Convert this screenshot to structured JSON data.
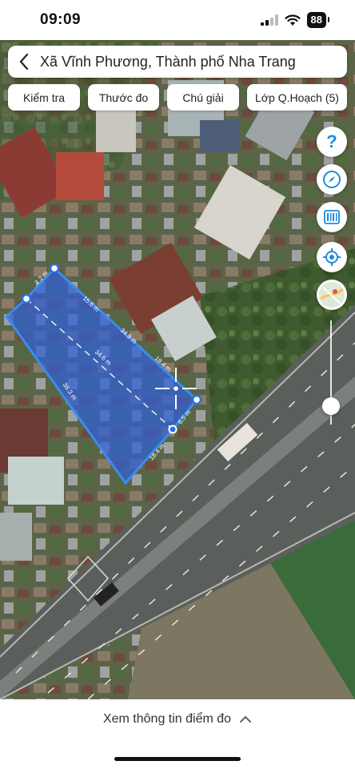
{
  "status_bar": {
    "time": "09:09",
    "battery": "88"
  },
  "search": {
    "location": "Xã Vĩnh Phương, Thành phố Nha Trang"
  },
  "toolbar": [
    {
      "label": "Kiểm tra"
    },
    {
      "label": "Thước đo"
    },
    {
      "label": "Chú giải"
    },
    {
      "label": "Lớp Q.Hoạch (5)"
    }
  ],
  "side_controls": [
    {
      "icon": "help-icon",
      "symbol": "?"
    },
    {
      "icon": "compass-icon"
    },
    {
      "icon": "barcode-icon"
    },
    {
      "icon": "locate-icon"
    },
    {
      "icon": "map-layer-thumbnail"
    }
  ],
  "zoom": {
    "level": 0.18
  },
  "parcel": {
    "edge_labels": [
      "7.2 m",
      "15.6 m",
      "34.9 m",
      "18.4 m",
      "6.5 m",
      "18.4 m",
      "36.3 m"
    ],
    "diagonal_label": "34.6 m",
    "fill_color": "#2f5fd8",
    "outline_color": "#3b8cf0"
  },
  "footer": {
    "info_label": "Xem thông tin điểm đo"
  }
}
